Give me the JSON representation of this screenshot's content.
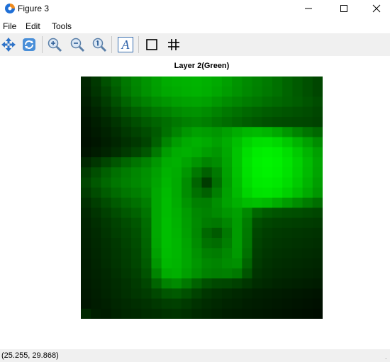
{
  "window": {
    "title": "Figure 3"
  },
  "menu": {
    "items": [
      "File",
      "Edit",
      "Tools"
    ]
  },
  "toolbar": {
    "icons": [
      "move-icon",
      "refresh-icon",
      "zoom-in-icon",
      "zoom-out-icon",
      "zoom-reset-icon",
      "text-icon",
      "rectangle-icon",
      "grid-icon"
    ],
    "text_tool_glyph": "A"
  },
  "axes": {
    "title": "Layer 2(Green)"
  },
  "status": {
    "coordinates": "(25.255, 29.868)",
    "grip": "."
  },
  "colors": {
    "accent": "#00ff00",
    "toolbar_bg": "#f0f0f0"
  },
  "chart_data": {
    "type": "heatmap",
    "title": "Layer 2(Green)",
    "colormap": "black-to-green",
    "rows": 24,
    "cols": 24,
    "values": [
      [
        38,
        56,
        80,
        100,
        120,
        135,
        148,
        160,
        172,
        176,
        178,
        180,
        176,
        170,
        160,
        148,
        138,
        130,
        122,
        112,
        100,
        90,
        80,
        70
      ],
      [
        35,
        52,
        70,
        92,
        116,
        132,
        146,
        158,
        168,
        172,
        176,
        178,
        174,
        166,
        156,
        146,
        136,
        128,
        120,
        112,
        100,
        90,
        80,
        70
      ],
      [
        30,
        44,
        60,
        80,
        100,
        118,
        130,
        142,
        150,
        158,
        162,
        164,
        160,
        150,
        140,
        132,
        124,
        118,
        110,
        104,
        98,
        92,
        84,
        76
      ],
      [
        25,
        36,
        50,
        66,
        82,
        96,
        108,
        120,
        128,
        138,
        144,
        146,
        140,
        130,
        120,
        112,
        104,
        98,
        92,
        88,
        84,
        80,
        76,
        70
      ],
      [
        20,
        30,
        40,
        52,
        66,
        78,
        90,
        100,
        110,
        120,
        128,
        132,
        126,
        116,
        108,
        100,
        92,
        86,
        80,
        76,
        74,
        72,
        70,
        66
      ],
      [
        18,
        26,
        34,
        44,
        56,
        66,
        76,
        90,
        112,
        132,
        150,
        160,
        156,
        150,
        160,
        172,
        182,
        186,
        180,
        168,
        150,
        132,
        116,
        104
      ],
      [
        16,
        22,
        30,
        38,
        48,
        56,
        68,
        96,
        132,
        156,
        170,
        176,
        170,
        160,
        172,
        190,
        210,
        222,
        224,
        216,
        200,
        180,
        160,
        140
      ],
      [
        20,
        28,
        36,
        46,
        58,
        70,
        86,
        120,
        156,
        172,
        176,
        170,
        158,
        150,
        168,
        196,
        222,
        236,
        240,
        236,
        222,
        202,
        180,
        160
      ],
      [
        40,
        54,
        70,
        86,
        102,
        116,
        130,
        150,
        172,
        176,
        164,
        148,
        132,
        140,
        164,
        196,
        226,
        240,
        244,
        240,
        228,
        210,
        188,
        166
      ],
      [
        60,
        78,
        96,
        112,
        124,
        134,
        144,
        160,
        178,
        172,
        150,
        120,
        96,
        120,
        160,
        194,
        224,
        238,
        242,
        238,
        226,
        208,
        186,
        164
      ],
      [
        70,
        88,
        104,
        118,
        128,
        136,
        146,
        164,
        182,
        170,
        140,
        100,
        60,
        110,
        156,
        190,
        220,
        234,
        236,
        232,
        220,
        202,
        180,
        158
      ],
      [
        60,
        76,
        92,
        106,
        118,
        126,
        138,
        168,
        186,
        170,
        140,
        112,
        96,
        126,
        160,
        186,
        212,
        226,
        228,
        222,
        208,
        190,
        170,
        150
      ],
      [
        48,
        62,
        76,
        90,
        102,
        112,
        126,
        168,
        188,
        172,
        148,
        128,
        126,
        142,
        162,
        176,
        188,
        192,
        186,
        172,
        156,
        140,
        124,
        110
      ],
      [
        40,
        52,
        64,
        76,
        88,
        98,
        116,
        168,
        188,
        176,
        156,
        136,
        130,
        138,
        150,
        160,
        136,
        102,
        90,
        84,
        80,
        78,
        74,
        70
      ],
      [
        36,
        46,
        56,
        66,
        76,
        86,
        108,
        168,
        190,
        178,
        158,
        138,
        124,
        120,
        134,
        156,
        124,
        78,
        70,
        66,
        64,
        62,
        60,
        58
      ],
      [
        34,
        42,
        52,
        62,
        70,
        80,
        104,
        168,
        190,
        180,
        160,
        136,
        104,
        90,
        120,
        156,
        120,
        70,
        62,
        58,
        56,
        54,
        52,
        50
      ],
      [
        32,
        40,
        48,
        56,
        66,
        76,
        100,
        166,
        190,
        182,
        164,
        140,
        114,
        108,
        126,
        156,
        118,
        66,
        58,
        54,
        52,
        50,
        48,
        46
      ],
      [
        30,
        38,
        46,
        54,
        62,
        72,
        96,
        160,
        188,
        182,
        166,
        146,
        128,
        124,
        136,
        154,
        112,
        62,
        54,
        50,
        48,
        46,
        44,
        42
      ],
      [
        28,
        36,
        44,
        52,
        60,
        70,
        90,
        150,
        184,
        180,
        166,
        150,
        136,
        132,
        140,
        144,
        100,
        58,
        50,
        46,
        44,
        42,
        40,
        38
      ],
      [
        28,
        34,
        40,
        48,
        56,
        64,
        82,
        132,
        172,
        176,
        160,
        144,
        130,
        126,
        128,
        120,
        84,
        52,
        46,
        42,
        40,
        38,
        36,
        34
      ],
      [
        26,
        32,
        38,
        44,
        50,
        58,
        70,
        100,
        130,
        138,
        120,
        98,
        80,
        72,
        70,
        64,
        54,
        44,
        40,
        36,
        34,
        32,
        30,
        28
      ],
      [
        24,
        30,
        36,
        42,
        48,
        54,
        60,
        72,
        86,
        90,
        80,
        66,
        54,
        48,
        44,
        40,
        36,
        32,
        30,
        28,
        26,
        24,
        22,
        20
      ],
      [
        22,
        28,
        32,
        38,
        42,
        46,
        50,
        56,
        62,
        64,
        58,
        50,
        44,
        40,
        36,
        34,
        30,
        28,
        26,
        24,
        22,
        20,
        18,
        16
      ],
      [
        40,
        30,
        28,
        34,
        38,
        40,
        44,
        46,
        50,
        52,
        48,
        42,
        38,
        34,
        30,
        28,
        26,
        24,
        22,
        20,
        18,
        16,
        14,
        12
      ]
    ]
  }
}
